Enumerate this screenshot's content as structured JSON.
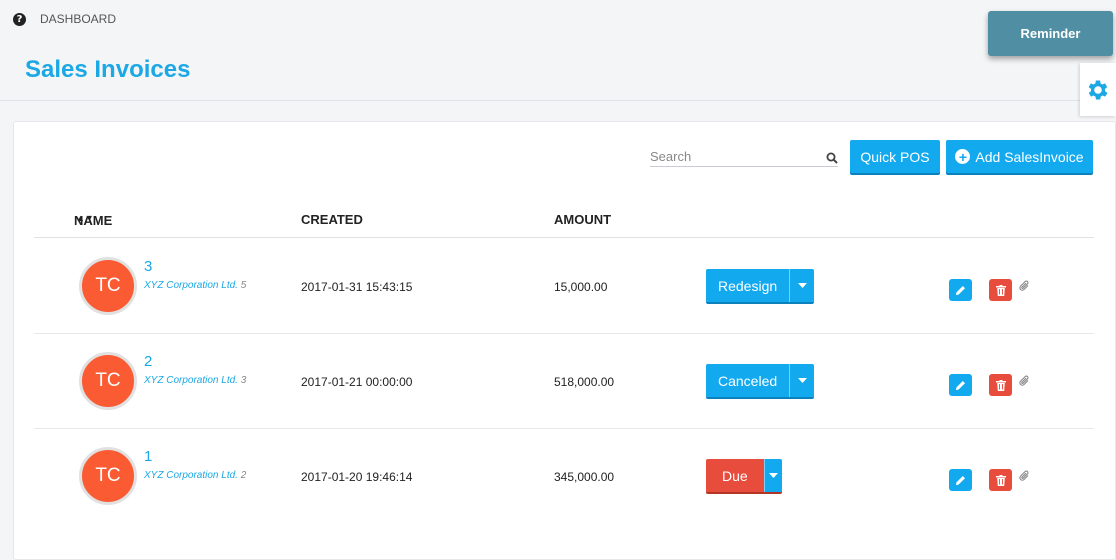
{
  "breadcrumb": {
    "label": "DASHBOARD"
  },
  "page": {
    "title": "Sales Invoices"
  },
  "reminder": {
    "label": "Reminder"
  },
  "toolbar": {
    "search_placeholder": "Search",
    "quick_pos_label": "Quick POS",
    "add_label": "Add SalesInvoice"
  },
  "table": {
    "headers": {
      "name": "NAME",
      "created": "CREATED",
      "amount": "AMOUNT"
    },
    "rows": [
      {
        "avatar": "TC",
        "number": "3",
        "company": "XYZ Corporation Ltd.",
        "company_count": "5",
        "created": "2017-01-31 15:43:15",
        "amount": "15,000.00",
        "status": "Redesign",
        "status_color": "#12a9ef"
      },
      {
        "avatar": "TC",
        "number": "2",
        "company": "XYZ Corporation Ltd.",
        "company_count": "3",
        "created": "2017-01-21 00:00:00",
        "amount": "518,000.00",
        "status": "Canceled",
        "status_color": "#12a9ef"
      },
      {
        "avatar": "TC",
        "number": "1",
        "company": "XYZ Corporation Ltd.",
        "company_count": "2",
        "created": "2017-01-20 19:46:14",
        "amount": "345,000.00",
        "status": "Due",
        "status_color": "#e74c3c"
      }
    ]
  },
  "colors": {
    "accent": "#1ba8e4",
    "button": "#12a9ef",
    "danger": "#e74c3c",
    "avatar": "#fa5b33",
    "reminder": "#4f8ea3"
  },
  "icons": [
    "help-icon",
    "gear-icon",
    "search-icon",
    "plus-circle-icon",
    "sort-icon",
    "caret-down-icon",
    "pencil-icon",
    "trash-icon",
    "paperclip-icon"
  ]
}
